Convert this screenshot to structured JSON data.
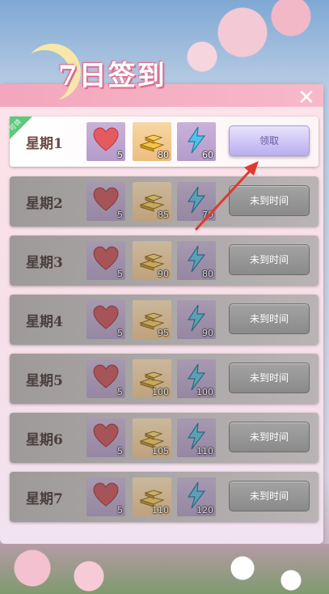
{
  "header": {
    "title": "7日签到"
  },
  "rows": [
    {
      "day": "星期1",
      "tag": "可领",
      "hearts": "5",
      "gold": "80",
      "energy": "60",
      "button": "领取"
    },
    {
      "day": "星期2",
      "hearts": "5",
      "gold": "85",
      "energy": "70",
      "button": "未到时间"
    },
    {
      "day": "星期3",
      "hearts": "5",
      "gold": "90",
      "energy": "80",
      "button": "未到时间"
    },
    {
      "day": "星期4",
      "hearts": "5",
      "gold": "95",
      "energy": "90",
      "button": "未到时间"
    },
    {
      "day": "星期5",
      "hearts": "5",
      "gold": "100",
      "energy": "100",
      "button": "未到时间"
    },
    {
      "day": "星期6",
      "hearts": "5",
      "gold": "105",
      "energy": "110",
      "button": "未到时间"
    },
    {
      "day": "星期7",
      "hearts": "5",
      "gold": "110",
      "energy": "120",
      "button": "未到时间"
    }
  ],
  "icons": {
    "close": "close-icon",
    "reward1": "heart-icon",
    "reward2": "gold-bar-icon",
    "reward3": "lightning-icon"
  },
  "colors": {
    "accent": "#f3a6bd",
    "claim": "#b8aef0",
    "tag": "#5dc97b",
    "arrow": "#e03a2f"
  }
}
